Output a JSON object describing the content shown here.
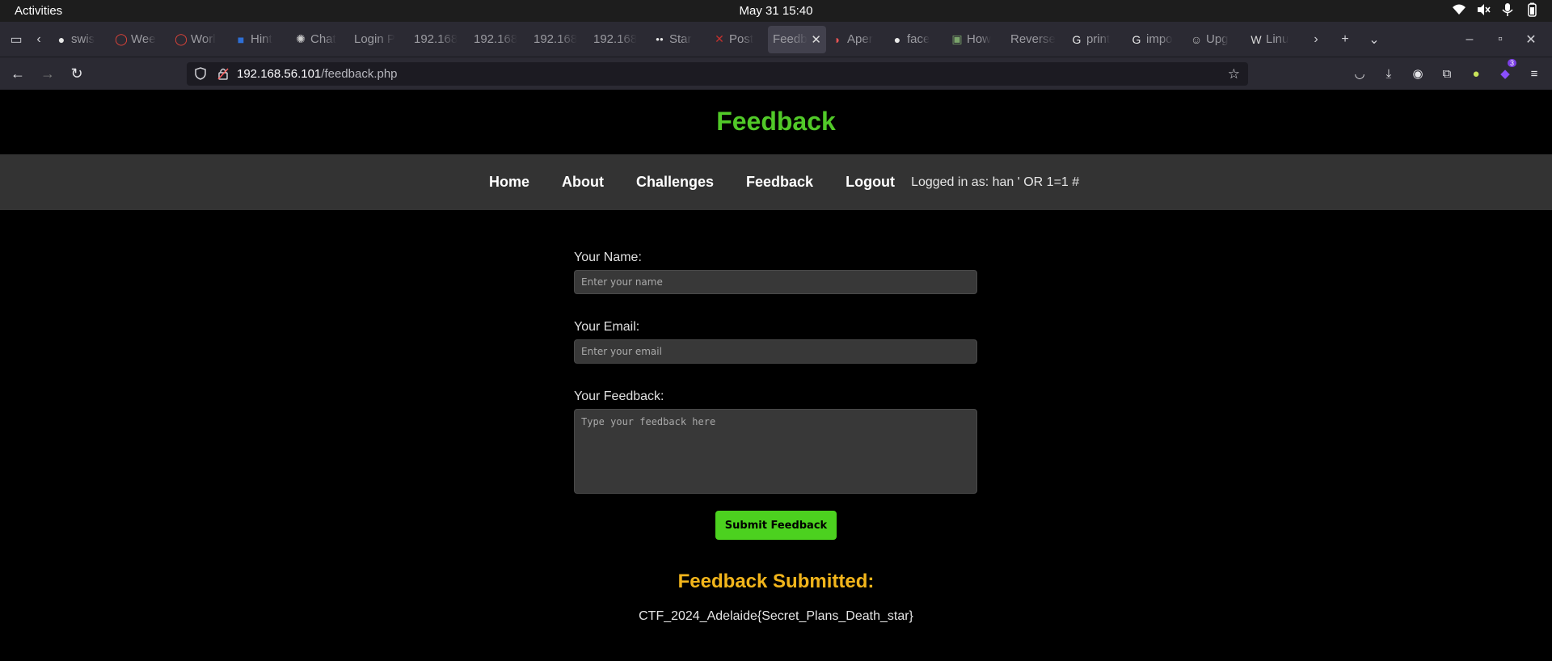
{
  "os": {
    "activities": "Activities",
    "clock": "May 31  15:40"
  },
  "browser": {
    "tabs": [
      {
        "label": "swis",
        "icon": "github-icon"
      },
      {
        "label": "Wee",
        "icon": "red-circle-icon"
      },
      {
        "label": "Worl",
        "icon": "red-circle-icon"
      },
      {
        "label": "Hint",
        "icon": "box-icon"
      },
      {
        "label": "Chat",
        "icon": "openai-icon"
      },
      {
        "label": "Login P",
        "icon": ""
      },
      {
        "label": "192.168",
        "icon": ""
      },
      {
        "label": "192.168",
        "icon": ""
      },
      {
        "label": "192.168",
        "icon": ""
      },
      {
        "label": "192.168",
        "icon": ""
      },
      {
        "label": "Star",
        "icon": "medium-icon"
      },
      {
        "label": "Post",
        "icon": "hackthebox-icon"
      },
      {
        "label": "Feedb",
        "icon": "",
        "active": true
      },
      {
        "label": "Aper",
        "icon": "melon-icon"
      },
      {
        "label": "face",
        "icon": "github-icon"
      },
      {
        "label": "How",
        "icon": "image-icon"
      },
      {
        "label": "Reverse",
        "icon": ""
      },
      {
        "label": "print",
        "icon": "google-icon"
      },
      {
        "label": "impo",
        "icon": "google-icon"
      },
      {
        "label": "Upg",
        "icon": "ghost-icon"
      },
      {
        "label": "Linu",
        "icon": "wordpress-icon"
      }
    ],
    "url_host": "192.168.56.101",
    "url_path": "/feedback.php",
    "extension_badge": "3"
  },
  "site": {
    "title": "Feedback",
    "nav": {
      "home": "Home",
      "about": "About",
      "challenges": "Challenges",
      "feedback": "Feedback",
      "logout": "Logout",
      "logged_in": "Logged in as: han ' OR 1=1 #"
    },
    "form": {
      "name_label": "Your Name:",
      "name_placeholder": "Enter your name",
      "email_label": "Your Email:",
      "email_placeholder": "Enter your email",
      "feedback_label": "Your Feedback:",
      "feedback_placeholder": "Type your feedback here",
      "submit_label": "Submit Feedback"
    },
    "result": {
      "heading": "Feedback Submitted:",
      "text": "CTF_2024_Adelaide{Secret_Plans_Death_star}"
    }
  },
  "colors": {
    "title_green": "#51c928",
    "button_green": "#4cd11f",
    "result_gold": "#f2b51b",
    "nav_bg": "#333333"
  }
}
